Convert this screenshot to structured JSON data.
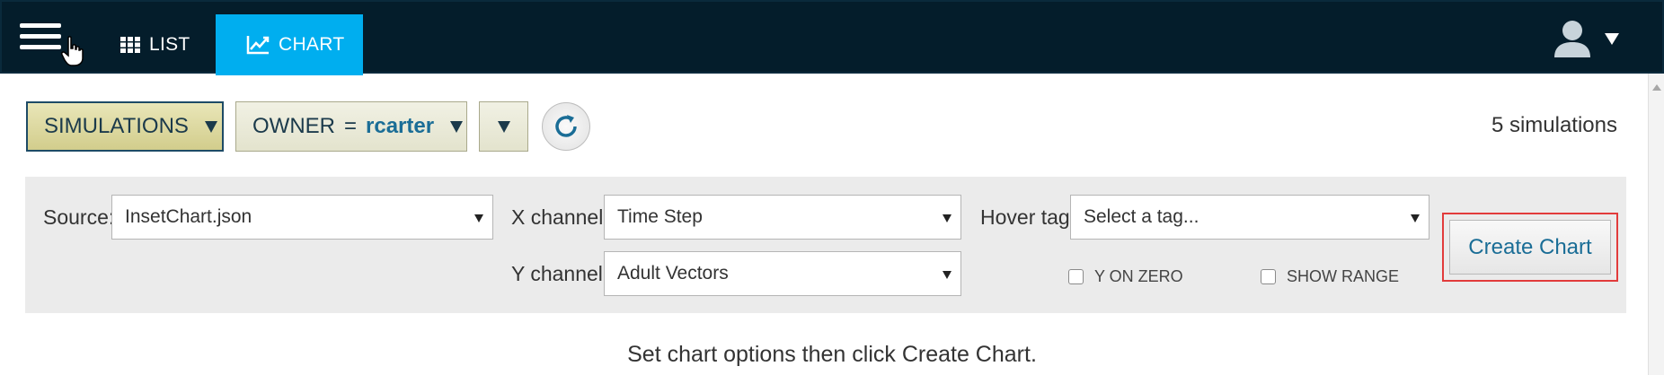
{
  "nav": {
    "menu_icon": "hamburger-menu-icon",
    "tabs": [
      {
        "label": "LIST",
        "icon": "grid-icon",
        "active": false
      },
      {
        "label": "CHART",
        "icon": "line-chart-icon",
        "active": true
      }
    ],
    "user_icon": "user-icon"
  },
  "toolbar": {
    "simulations_label": "SIMULATIONS",
    "owner_label": "OWNER",
    "owner_operator": "=",
    "owner_value": "rcarter",
    "refresh_icon": "refresh-icon",
    "count_text": "5 simulations"
  },
  "options": {
    "source_label": "Source:",
    "source_value": "InsetChart.json",
    "x_channel_label": "X channel:",
    "x_channel_value": "Time Step",
    "y_channel_label": "Y channel:",
    "y_channel_value": "Adult Vectors",
    "hover_tag_label": "Hover tag:",
    "hover_tag_placeholder": "Select a tag...",
    "y_on_zero_label": "Y ON ZERO",
    "y_on_zero_checked": false,
    "show_range_label": "SHOW RANGE",
    "show_range_checked": false,
    "create_chart_label": "Create Chart"
  },
  "hint": "Set chart options then click Create Chart.",
  "colors": {
    "topbar": "#041d2b",
    "active_tab": "#00aeef",
    "accent_text": "#1a6d96",
    "highlight": "#e23b3b"
  }
}
